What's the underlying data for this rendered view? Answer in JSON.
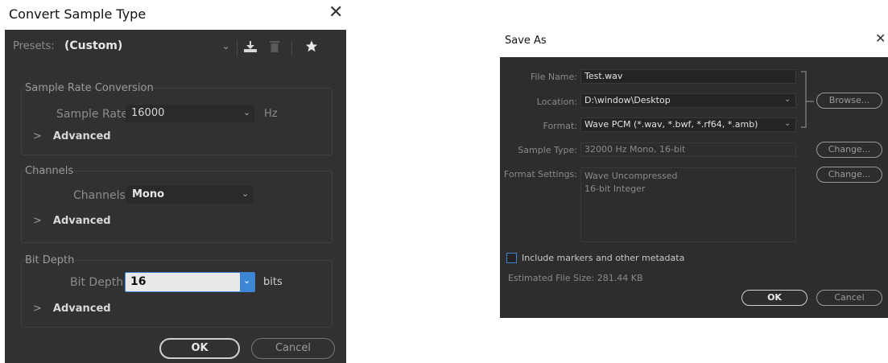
{
  "convert_dialog": {
    "title": "Convert Sample Type",
    "close_glyph": "✕",
    "presets": {
      "label": "Presets:",
      "value": "(Custom)"
    },
    "sample_rate_group": {
      "title": "Sample Rate Conversion",
      "label": "Sample Rate:",
      "value": "16000",
      "unit": "Hz",
      "advanced": "Advanced"
    },
    "channels_group": {
      "title": "Channels",
      "label": "Channels:",
      "value": "Mono",
      "advanced": "Advanced"
    },
    "bit_depth_group": {
      "title": "Bit Depth",
      "label": "Bit Depth:",
      "value": "16",
      "unit": "bits",
      "advanced": "Advanced"
    },
    "ok_label": "OK",
    "cancel_label": "Cancel"
  },
  "save_as_dialog": {
    "title": "Save As",
    "close_glyph": "✕",
    "file_name": {
      "label": "File Name:",
      "value": "Test.wav"
    },
    "location": {
      "label": "Location:",
      "value": "D:\\window\\Desktop"
    },
    "format": {
      "label": "Format:",
      "value": "Wave PCM (*.wav, *.bwf, *.rf64, *.amb)"
    },
    "browse_label": "Browse...",
    "sample_type": {
      "label": "Sample Type:",
      "value": "32000 Hz Mono, 16-bit",
      "change_label": "Change..."
    },
    "format_settings": {
      "label": "Format Settings:",
      "line1": "Wave Uncompressed",
      "line2": "16-bit Integer",
      "change_label": "Change..."
    },
    "include_markers_label": "Include markers and other metadata",
    "estimated_size": "Estimated File Size: 281.44 KB",
    "ok_label": "OK",
    "cancel_label": "Cancel"
  },
  "colors": {
    "dialog_bg": "#313131",
    "focus_border": "#3d86d6",
    "checkbox_border": "#3d86d6"
  }
}
